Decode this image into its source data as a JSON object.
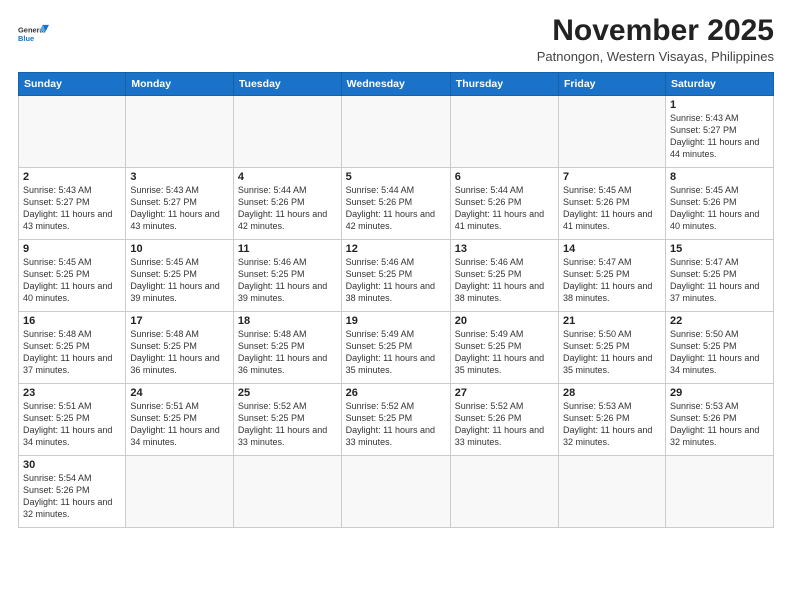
{
  "logo": {
    "line1": "General",
    "line2": "Blue"
  },
  "title": "November 2025",
  "subtitle": "Patnongon, Western Visayas, Philippines",
  "days_of_week": [
    "Sunday",
    "Monday",
    "Tuesday",
    "Wednesday",
    "Thursday",
    "Friday",
    "Saturday"
  ],
  "weeks": [
    [
      {
        "num": "",
        "info": ""
      },
      {
        "num": "",
        "info": ""
      },
      {
        "num": "",
        "info": ""
      },
      {
        "num": "",
        "info": ""
      },
      {
        "num": "",
        "info": ""
      },
      {
        "num": "",
        "info": ""
      },
      {
        "num": "1",
        "info": "Sunrise: 5:43 AM\nSunset: 5:27 PM\nDaylight: 11 hours\nand 44 minutes."
      }
    ],
    [
      {
        "num": "2",
        "info": "Sunrise: 5:43 AM\nSunset: 5:27 PM\nDaylight: 11 hours\nand 43 minutes."
      },
      {
        "num": "3",
        "info": "Sunrise: 5:43 AM\nSunset: 5:27 PM\nDaylight: 11 hours\nand 43 minutes."
      },
      {
        "num": "4",
        "info": "Sunrise: 5:44 AM\nSunset: 5:26 PM\nDaylight: 11 hours\nand 42 minutes."
      },
      {
        "num": "5",
        "info": "Sunrise: 5:44 AM\nSunset: 5:26 PM\nDaylight: 11 hours\nand 42 minutes."
      },
      {
        "num": "6",
        "info": "Sunrise: 5:44 AM\nSunset: 5:26 PM\nDaylight: 11 hours\nand 41 minutes."
      },
      {
        "num": "7",
        "info": "Sunrise: 5:45 AM\nSunset: 5:26 PM\nDaylight: 11 hours\nand 41 minutes."
      },
      {
        "num": "8",
        "info": "Sunrise: 5:45 AM\nSunset: 5:26 PM\nDaylight: 11 hours\nand 40 minutes."
      }
    ],
    [
      {
        "num": "9",
        "info": "Sunrise: 5:45 AM\nSunset: 5:25 PM\nDaylight: 11 hours\nand 40 minutes."
      },
      {
        "num": "10",
        "info": "Sunrise: 5:45 AM\nSunset: 5:25 PM\nDaylight: 11 hours\nand 39 minutes."
      },
      {
        "num": "11",
        "info": "Sunrise: 5:46 AM\nSunset: 5:25 PM\nDaylight: 11 hours\nand 39 minutes."
      },
      {
        "num": "12",
        "info": "Sunrise: 5:46 AM\nSunset: 5:25 PM\nDaylight: 11 hours\nand 38 minutes."
      },
      {
        "num": "13",
        "info": "Sunrise: 5:46 AM\nSunset: 5:25 PM\nDaylight: 11 hours\nand 38 minutes."
      },
      {
        "num": "14",
        "info": "Sunrise: 5:47 AM\nSunset: 5:25 PM\nDaylight: 11 hours\nand 38 minutes."
      },
      {
        "num": "15",
        "info": "Sunrise: 5:47 AM\nSunset: 5:25 PM\nDaylight: 11 hours\nand 37 minutes."
      }
    ],
    [
      {
        "num": "16",
        "info": "Sunrise: 5:48 AM\nSunset: 5:25 PM\nDaylight: 11 hours\nand 37 minutes."
      },
      {
        "num": "17",
        "info": "Sunrise: 5:48 AM\nSunset: 5:25 PM\nDaylight: 11 hours\nand 36 minutes."
      },
      {
        "num": "18",
        "info": "Sunrise: 5:48 AM\nSunset: 5:25 PM\nDaylight: 11 hours\nand 36 minutes."
      },
      {
        "num": "19",
        "info": "Sunrise: 5:49 AM\nSunset: 5:25 PM\nDaylight: 11 hours\nand 35 minutes."
      },
      {
        "num": "20",
        "info": "Sunrise: 5:49 AM\nSunset: 5:25 PM\nDaylight: 11 hours\nand 35 minutes."
      },
      {
        "num": "21",
        "info": "Sunrise: 5:50 AM\nSunset: 5:25 PM\nDaylight: 11 hours\nand 35 minutes."
      },
      {
        "num": "22",
        "info": "Sunrise: 5:50 AM\nSunset: 5:25 PM\nDaylight: 11 hours\nand 34 minutes."
      }
    ],
    [
      {
        "num": "23",
        "info": "Sunrise: 5:51 AM\nSunset: 5:25 PM\nDaylight: 11 hours\nand 34 minutes."
      },
      {
        "num": "24",
        "info": "Sunrise: 5:51 AM\nSunset: 5:25 PM\nDaylight: 11 hours\nand 34 minutes."
      },
      {
        "num": "25",
        "info": "Sunrise: 5:52 AM\nSunset: 5:25 PM\nDaylight: 11 hours\nand 33 minutes."
      },
      {
        "num": "26",
        "info": "Sunrise: 5:52 AM\nSunset: 5:25 PM\nDaylight: 11 hours\nand 33 minutes."
      },
      {
        "num": "27",
        "info": "Sunrise: 5:52 AM\nSunset: 5:26 PM\nDaylight: 11 hours\nand 33 minutes."
      },
      {
        "num": "28",
        "info": "Sunrise: 5:53 AM\nSunset: 5:26 PM\nDaylight: 11 hours\nand 32 minutes."
      },
      {
        "num": "29",
        "info": "Sunrise: 5:53 AM\nSunset: 5:26 PM\nDaylight: 11 hours\nand 32 minutes."
      }
    ],
    [
      {
        "num": "30",
        "info": "Sunrise: 5:54 AM\nSunset: 5:26 PM\nDaylight: 11 hours\nand 32 minutes."
      },
      {
        "num": "",
        "info": ""
      },
      {
        "num": "",
        "info": ""
      },
      {
        "num": "",
        "info": ""
      },
      {
        "num": "",
        "info": ""
      },
      {
        "num": "",
        "info": ""
      },
      {
        "num": "",
        "info": ""
      }
    ]
  ]
}
